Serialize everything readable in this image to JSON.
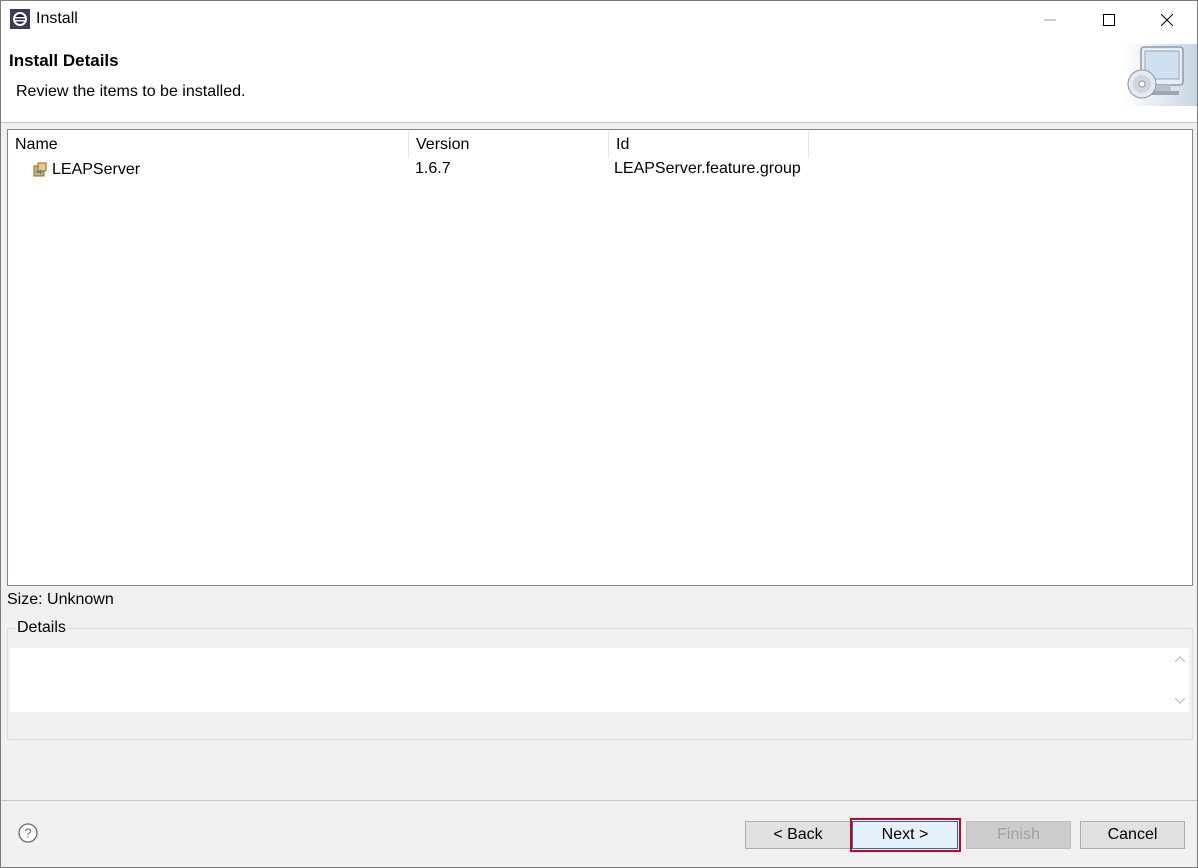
{
  "window": {
    "title": "Install",
    "icon": "eclipse-icon"
  },
  "header": {
    "title": "Install Details",
    "subtitle": "Review the items to be installed.",
    "image": "install-monitor-cd-icon"
  },
  "table": {
    "columns": [
      "Name",
      "Version",
      "Id"
    ],
    "rows": [
      {
        "name": "LEAPServer",
        "version": "1.6.7",
        "id": "LEAPServer.feature.group",
        "icon": "feature-icon"
      }
    ]
  },
  "size_label": "Size: Unknown",
  "details": {
    "label": "Details",
    "text": ""
  },
  "buttons": {
    "back": "< Back",
    "next": "Next >",
    "finish": "Finish",
    "cancel": "Cancel"
  },
  "colors": {
    "highlight_outline": "#d0021b",
    "focus_border": "#0078d7"
  }
}
